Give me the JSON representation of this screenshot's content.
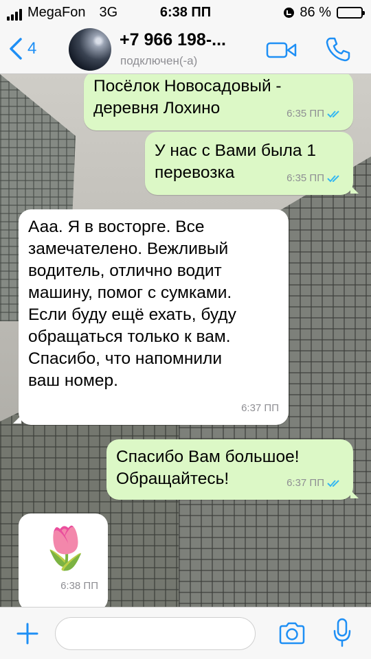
{
  "status_bar": {
    "carrier": "MegaFon",
    "network": "3G",
    "time": "6:38 ПП",
    "battery": "86 %",
    "battery_level": 0.86
  },
  "header": {
    "back_count": "4",
    "contact_name": "+7 966 198-...",
    "contact_status": "подключен(-а)",
    "accent_color": "#1e8ff5"
  },
  "messages": [
    {
      "direction": "out",
      "text": "Посёлок Новосадовый -\nдеревня Лохино",
      "time": "6:35 ПП",
      "read": true
    },
    {
      "direction": "out",
      "text": "У нас с Вами была 1\nперевозка",
      "time": "6:35 ПП",
      "read": true
    },
    {
      "direction": "in",
      "text": "Ааа. Я в восторге. Все\nзамечателено. Вежливый\nводитель, отлично водит\nмашину, помог с сумками.\nЕсли буду ещё ехать, буду\nобращаться только к вам.\nСпасибо, что напомнили\nваш номер.",
      "time": "6:37 ПП"
    },
    {
      "direction": "out",
      "text": "Спасибо Вам большое!\nОбращайтесь!",
      "time": "6:37 ПП",
      "read": true
    },
    {
      "direction": "in",
      "emoji": "🌷",
      "time": "6:38 ПП"
    }
  ],
  "colors": {
    "outgoing_bubble": "#dcf8c6",
    "incoming_bubble": "#ffffff",
    "read_ticks": "#34b7f1"
  },
  "input_bar": {
    "placeholder": ""
  }
}
